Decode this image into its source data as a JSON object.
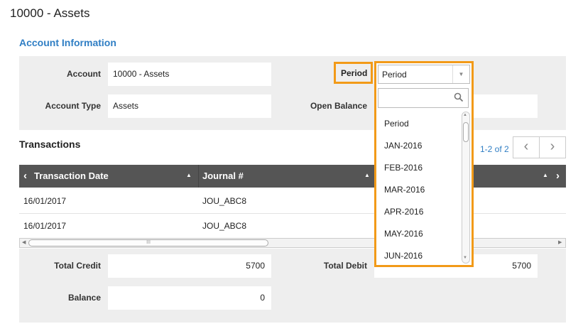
{
  "page": {
    "title": "10000 - Assets"
  },
  "account_info": {
    "heading": "Account Information",
    "account_label": "Account",
    "account_value": "10000 - Assets",
    "account_type_label": "Account Type",
    "account_type_value": "Assets",
    "period_label": "Period",
    "open_balance_label": "Open Balance"
  },
  "period_dropdown": {
    "selected": "Period",
    "search_placeholder": "",
    "options": [
      "Period",
      "JAN-2016",
      "FEB-2016",
      "MAR-2016",
      "APR-2016",
      "MAY-2016",
      "JUN-2016"
    ]
  },
  "transactions": {
    "heading": "Transactions",
    "pager_text": "1-2 of 2",
    "prev_icon": "chevron-left-icon",
    "next_icon": "chevron-right-icon",
    "columns": [
      "Transaction Date",
      "Journal #"
    ],
    "rows": [
      {
        "date": "16/01/2017",
        "journal": "JOU_ABC8"
      },
      {
        "date": "16/01/2017",
        "journal": "JOU_ABC8"
      }
    ],
    "scroll_grip": "III"
  },
  "totals": {
    "total_credit_label": "Total Credit",
    "total_credit_value": "5700",
    "total_debit_label": "Total Debit",
    "total_debit_value": "5700",
    "balance_label": "Balance",
    "balance_value": "0"
  },
  "colors": {
    "accent_orange": "#f29a18",
    "link_blue": "#2f7ec4",
    "grid_header": "#555555",
    "panel_bg": "#eeeeee"
  }
}
